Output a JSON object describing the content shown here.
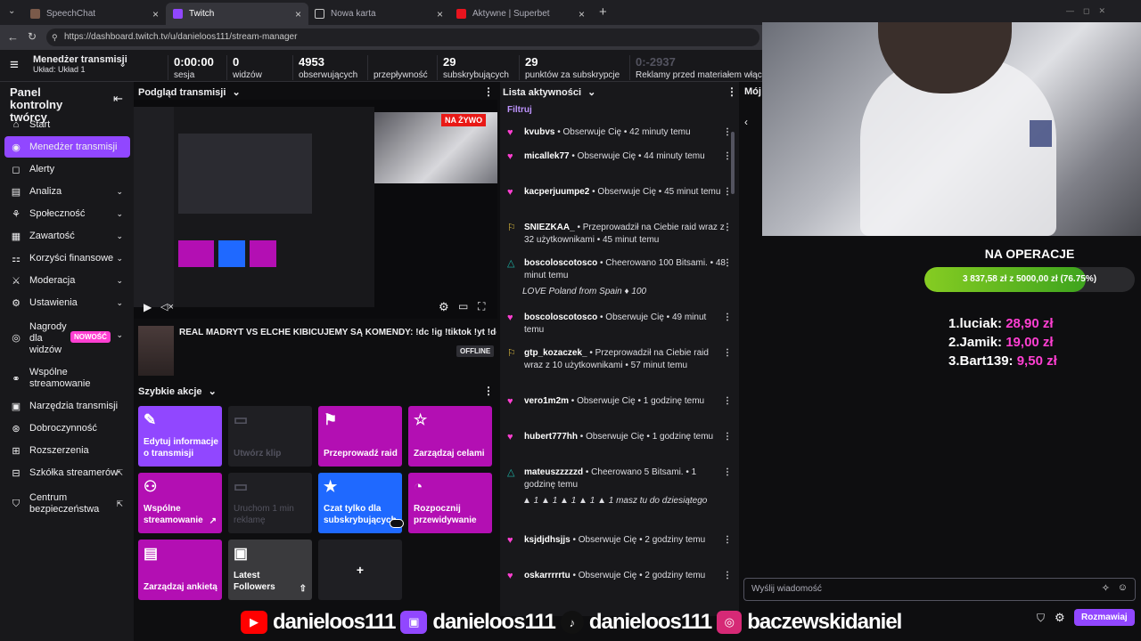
{
  "browser": {
    "tabs": [
      {
        "title": "SpeechChat",
        "icon_color": "#7a5a4a"
      },
      {
        "title": "Twitch",
        "icon_color": "#9147ff"
      },
      {
        "title": "Nowa karta",
        "icon_color": "#c8c8c8"
      },
      {
        "title": "Aktywne | Superbet",
        "icon_color": "#e8141e"
      }
    ],
    "url": "https://dashboard.twitch.tv/u/danieloos111/stream-manager"
  },
  "header": {
    "title": "Menedżer transmisji",
    "layout": "Układ: Układ 1",
    "stats": [
      {
        "value": "0:00:00",
        "label": "sesja"
      },
      {
        "value": "0",
        "label": "widzów"
      },
      {
        "value": "4953",
        "label": "obserwujących"
      },
      {
        "value": "",
        "label": "przepływność"
      },
      {
        "value": "29",
        "label": "subskrybujących"
      },
      {
        "value": "29",
        "label": "punktów za subskrypcje"
      },
      {
        "value": "0:-2937",
        "label": "Reklamy przed materiałem włączo"
      }
    ]
  },
  "sidebar": {
    "title": "Panel kontrolny twórcy",
    "items": [
      {
        "label": "Start",
        "icon": "home-icon",
        "glyph": "⌂"
      },
      {
        "label": "Menedżer transmisji",
        "icon": "broadcast-icon",
        "glyph": "◉"
      },
      {
        "label": "Alerty",
        "icon": "alert-icon",
        "glyph": "◻"
      },
      {
        "label": "Analiza",
        "icon": "analytics-icon",
        "glyph": "▤"
      },
      {
        "label": "Społeczność",
        "icon": "community-icon",
        "glyph": "⚘"
      },
      {
        "label": "Zawartość",
        "icon": "content-icon",
        "glyph": "▦"
      },
      {
        "label": "Korzyści finansowe",
        "icon": "monetization-icon",
        "glyph": "⚏"
      },
      {
        "label": "Moderacja",
        "icon": "moderation-icon",
        "glyph": "⚔"
      },
      {
        "label": "Ustawienia",
        "icon": "settings-icon",
        "glyph": "⚙"
      },
      {
        "label": "Nagrody dla widzów",
        "icon": "rewards-icon",
        "glyph": "◎",
        "badge": "NOWOŚĆ"
      },
      {
        "label": "Wspólne streamowanie",
        "icon": "collab-icon",
        "glyph": "⚭"
      },
      {
        "label": "Narzędzia transmisji",
        "icon": "tools-icon",
        "glyph": "▣"
      },
      {
        "label": "Dobroczynność",
        "icon": "charity-icon",
        "glyph": "⊛"
      },
      {
        "label": "Rozszerzenia",
        "icon": "extensions-icon",
        "glyph": "⊞"
      },
      {
        "label": "Szkółka streamerów",
        "icon": "academy-icon",
        "glyph": "⊟"
      },
      {
        "label": "Centrum bezpieczeństwa",
        "icon": "safety-icon",
        "glyph": "⛉"
      }
    ]
  },
  "preview": {
    "title": "Podgląd transmisji",
    "live": "NA ŻYWO",
    "stream_title": "REAL MADRYT VS ELCHE KIBICUJEMY SĄ KOMENDY: !dc !ig !tiktok !yt !donate !",
    "status": "OFFLINE"
  },
  "quick_actions": {
    "title": "Szybkie akcje",
    "items": [
      {
        "label": "Edytuj informacje o transmisji",
        "glyph": "✎",
        "style": "purple"
      },
      {
        "label": "Utwórz klip",
        "glyph": "▭",
        "style": "grey"
      },
      {
        "label": "Przeprowadź raid",
        "glyph": "⚑",
        "style": "pink"
      },
      {
        "label": "Zarządzaj celami",
        "glyph": "☆",
        "style": "pink"
      },
      {
        "label": "Wspólne streamowanie",
        "glyph": "⚇",
        "style": "pink"
      },
      {
        "label": "Uruchom 1 min reklamę",
        "glyph": "▭",
        "style": "grey"
      },
      {
        "label": "Czat tylko dla subskrybujących",
        "glyph": "★",
        "style": "blue"
      },
      {
        "label": "Rozpocznij przewidywanie",
        "glyph": "◔",
        "style": "pink"
      },
      {
        "label": "Zarządzaj ankietą",
        "glyph": "▤",
        "style": "pink"
      },
      {
        "label": "Latest Followers",
        "glyph": "▣",
        "style": "plain"
      }
    ],
    "add": "+"
  },
  "activity": {
    "title": "Lista aktywności",
    "filter": "Filtruj",
    "items": [
      {
        "icon": "♥",
        "user": "kvubvs",
        "action": " • Obserwuje Cię • 42 minuty temu",
        "color": "#ff3fd2"
      },
      {
        "icon": "♥",
        "user": "micallek77",
        "action": " • Obserwuje Cię • 44 minuty temu",
        "color": "#ff3fd2"
      },
      {
        "icon": "♥",
        "user": "kacperjuumpe2",
        "action": " • Obserwuje Cię • 45 minut temu",
        "color": "#ff3fd2"
      },
      {
        "icon": "⚐",
        "user": "SNIEZKAA_",
        "action": " • Przeprowadził na Ciebie raid wraz z 32 użytkownikami • 45 minut temu",
        "color": "#e6c23e"
      },
      {
        "icon": "△",
        "user": "boscoloscotosco",
        "action": " • Cheerowano 100 Bitsami. • 48 minut temu",
        "color": "#1db2a5",
        "note": "LOVE Poland from Spain ♦ 100"
      },
      {
        "icon": "♥",
        "user": "boscoloscotosco",
        "action": " • Obserwuje Cię • 49 minut temu",
        "color": "#ff3fd2"
      },
      {
        "icon": "⚐",
        "user": "gtp_kozaczek_",
        "action": " • Przeprowadził na Ciebie raid wraz z 10 użytkownikami • 57 minut temu",
        "color": "#e6c23e"
      },
      {
        "icon": "♥",
        "user": "vero1m2m",
        "action": " • Obserwuje Cię • 1 godzinę temu",
        "color": "#ff3fd2"
      },
      {
        "icon": "♥",
        "user": "hubert777hh",
        "action": " • Obserwuje Cię • 1 godzinę temu",
        "color": "#ff3fd2"
      },
      {
        "icon": "△",
        "user": "mateuszzzzzd",
        "action": " • Cheerowano 5 Bitsami. • 1 godzinę temu",
        "color": "#1db2a5",
        "note": "▲ 1 ▲ 1 ▲ 1 ▲ 1 ▲ 1 masz tu do dziesiątego"
      },
      {
        "icon": "♥",
        "user": "ksjdjdhsjjs",
        "action": " • Obserwuje Cię • 2 godziny temu",
        "color": "#ff3fd2"
      },
      {
        "icon": "♥",
        "user": "oskarrrrrtu",
        "action": " • Obserwuje Cię • 2 godziny temu",
        "color": "#ff3fd2"
      }
    ]
  },
  "chat": {
    "header": "Mój",
    "placeholder": "Wyślij wiadomość",
    "send": "Rozmawiaj"
  },
  "overlay": {
    "goal_title": "NA OPERACJE",
    "goal_text": "3 837,58 zł z 5000,00 zł (76.75%)",
    "goal_fraction": 0.7675,
    "ranks": [
      {
        "name": "1.luciak: ",
        "amount": "28,90 zł"
      },
      {
        "name": "2.Jamik: ",
        "amount": "19,00 zł"
      },
      {
        "name": "3.Bart139: ",
        "amount": "9,50 zł"
      }
    ]
  },
  "socials": [
    {
      "name": "danieloos111",
      "icon": "youtube-icon",
      "color": "#ff0000",
      "glyph": "▶"
    },
    {
      "name": "danieloos111",
      "icon": "twitch-icon",
      "color": "#9147ff",
      "glyph": "▣"
    },
    {
      "name": "danieloos111",
      "icon": "tiktok-icon",
      "color": "#111111",
      "glyph": "♪"
    },
    {
      "name": "baczewskidaniel",
      "icon": "instagram-icon",
      "color": "#d62976",
      "glyph": "◎"
    }
  ]
}
